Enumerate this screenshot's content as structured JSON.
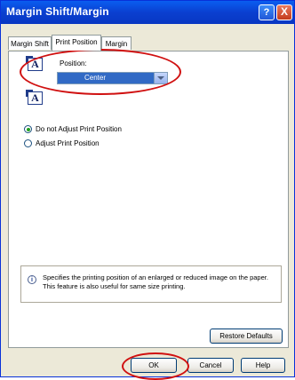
{
  "window": {
    "title": "Margin Shift/Margin"
  },
  "titlebar": {
    "help_glyph": "?",
    "close_glyph": "X"
  },
  "tabs": [
    {
      "label": "Margin Shift",
      "active": false
    },
    {
      "label": "Print Position",
      "active": true
    },
    {
      "label": "Margin",
      "active": false
    }
  ],
  "position": {
    "label": "Position:",
    "selected": "Center"
  },
  "radios": [
    {
      "label": "Do not Adjust Print Position",
      "checked": true
    },
    {
      "label": "Adjust Print Position",
      "checked": false
    }
  ],
  "info": {
    "icon": "info-icon",
    "text": "Specifies the printing position of an enlarged or reduced image on the paper. This feature is also useful for same size printing."
  },
  "buttons": {
    "restore_defaults": "Restore Defaults",
    "ok": "OK",
    "cancel": "Cancel",
    "help": "Help"
  },
  "colors": {
    "titlebar": "#0a3fd0",
    "selection": "#316ac5",
    "highlight_annotation": "#d01010"
  }
}
